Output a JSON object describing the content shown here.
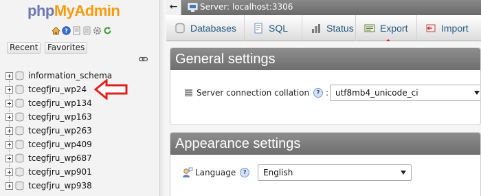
{
  "nav": {
    "logo_part1": "php",
    "logo_part2": "MyAdmin",
    "icons": [
      "home-icon",
      "info-icon",
      "docs-icon",
      "docs-alt-icon",
      "settings-icon",
      "reload-icon"
    ],
    "tabs": {
      "recent": "Recent",
      "favorites": "Favorites"
    },
    "databases": [
      "information_schema",
      "tcegfjru_wp24",
      "tcegfjru_wp134",
      "tcegfjru_wp163",
      "tcegfjru_wp263",
      "tcegfjru_wp409",
      "tcegfjru_wp687",
      "tcegfjru_wp901",
      "tcegfjru_wp938"
    ]
  },
  "topbar": {
    "back": "←",
    "server_label": "Server: localhost:3306"
  },
  "menu": {
    "items": [
      {
        "label": "Databases",
        "icon": "database-icon"
      },
      {
        "label": "SQL",
        "icon": "sql-icon"
      },
      {
        "label": "Status",
        "icon": "status-icon"
      },
      {
        "label": "Export",
        "icon": "export-icon"
      },
      {
        "label": "Import",
        "icon": "import-icon"
      }
    ]
  },
  "general": {
    "title": "General settings",
    "collation_label": "Server connection collation",
    "collation_value": "utf8mb4_unicode_ci"
  },
  "appearance": {
    "title": "Appearance settings",
    "language_label": "Language",
    "language_value": "English"
  },
  "colors": {
    "logo_blue": "#6c78af",
    "logo_orange": "#f89c0e",
    "link_blue": "#235a81",
    "annotation_red": "#e0201c"
  }
}
